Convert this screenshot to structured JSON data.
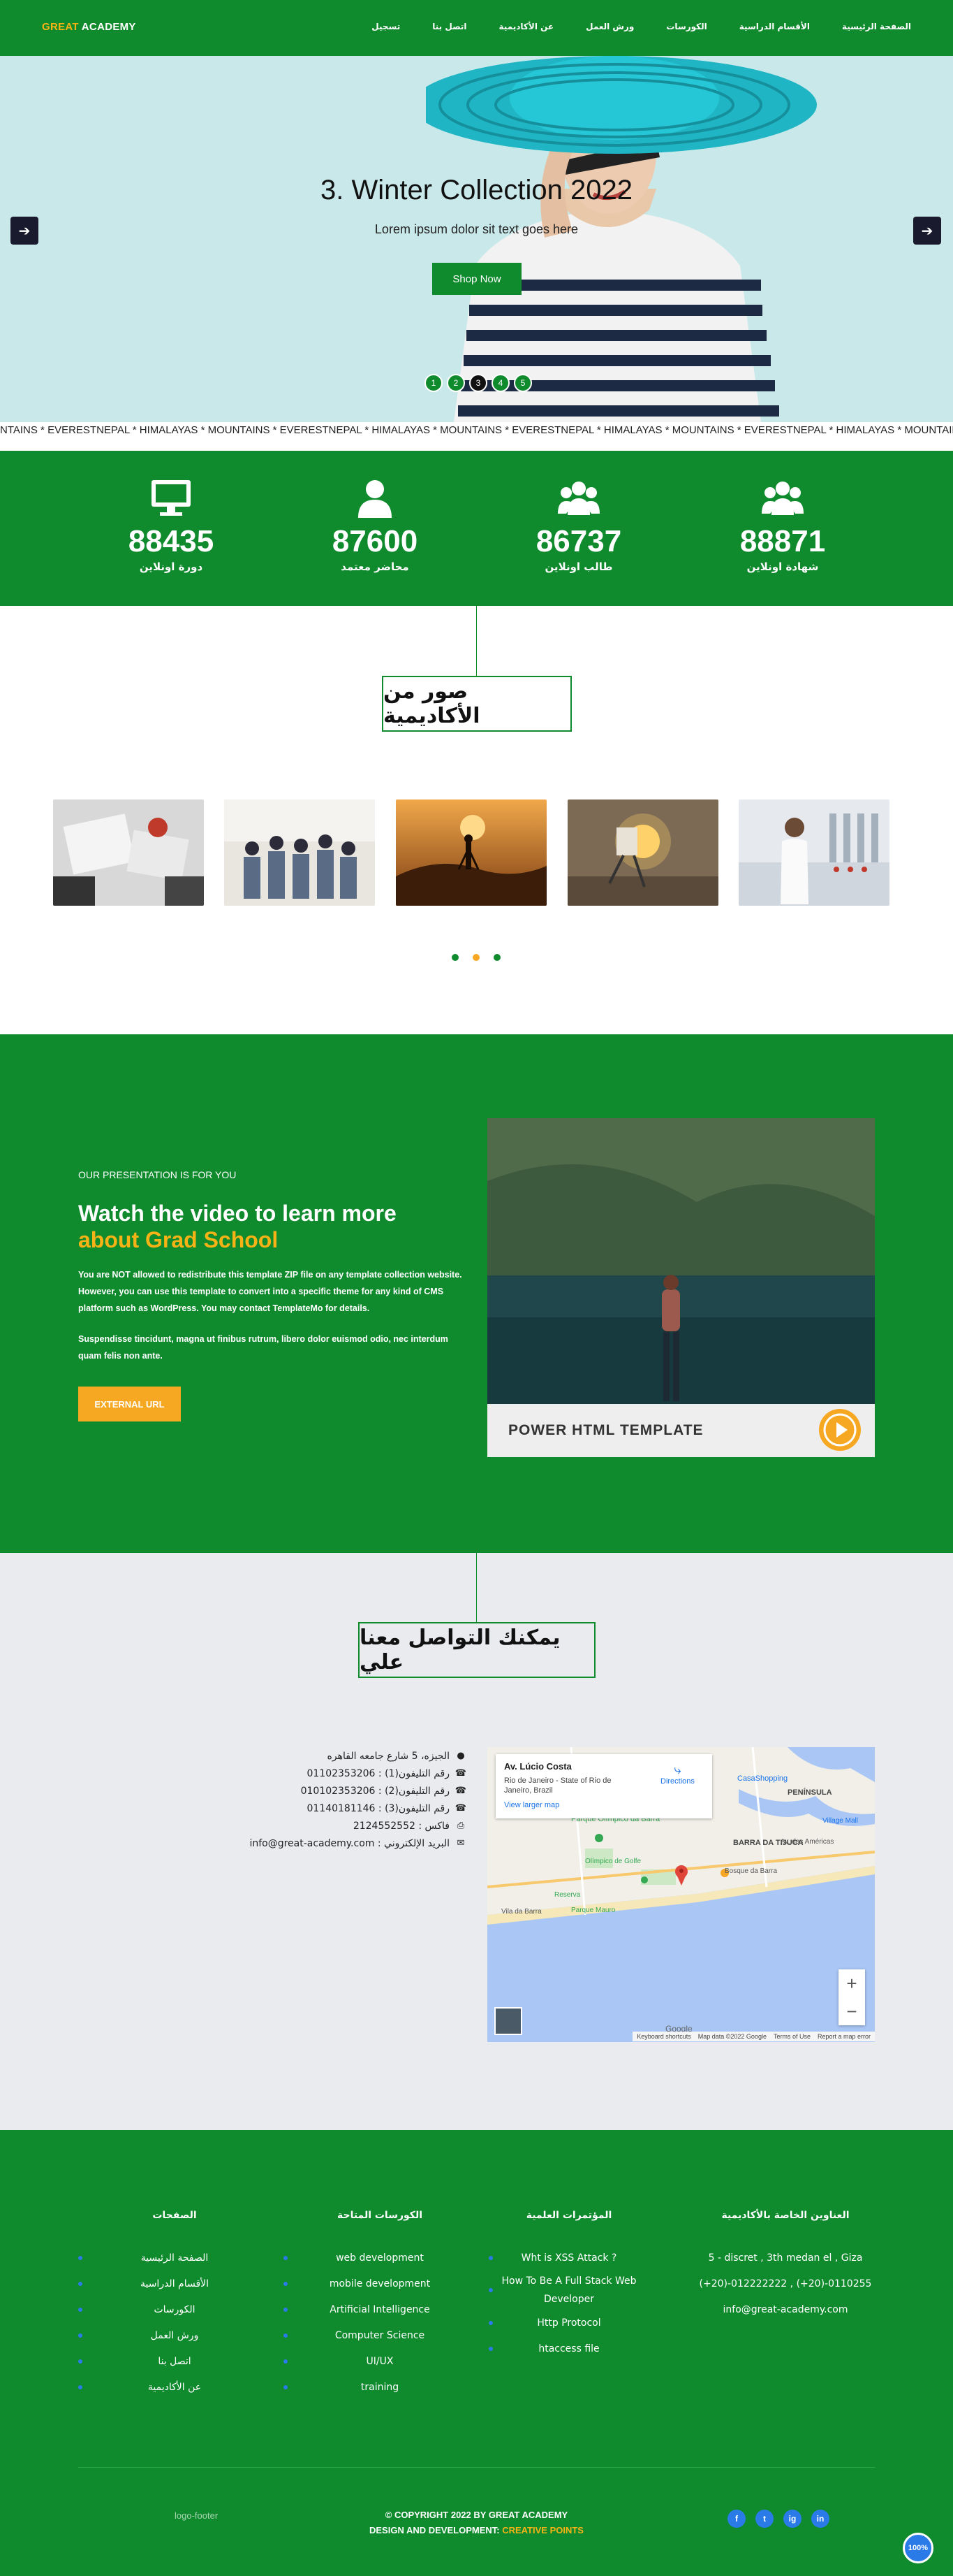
{
  "nav": {
    "brand_main": "GREAT",
    "brand_rest": " ACADEMY",
    "items": [
      "الصفحة الرئيسية",
      "الأقسام الدراسية",
      "الكورسات",
      "ورش العمل",
      "عن الأكاديمية",
      "اتصل بنا",
      "تسجيل"
    ]
  },
  "hero": {
    "title": "3. Winter Collection 2022",
    "subtitle": "Lorem ipsum dolor sit text goes here",
    "button": "Shop Now",
    "prev_icon": "arrow-left-icon",
    "next_icon": "arrow-right-icon",
    "dots": [
      "1",
      "2",
      "3",
      "4",
      "5"
    ],
    "active_dot": 3
  },
  "ticker": "NTAINS * EVERESTNEPAL * HIMALAYAS * MOUNTAINS * EVERESTNEPAL * HIMALAYAS * MOUNTAINS * EVERESTNEPAL * HIMALAYAS * MOUNTAINS * EVERESTNEPAL * HIMALAYAS * MOUNTAINS * EVERESTNEPAL * HIMALAYAS * MOUNTAINS * EVERESTNEPAL * HIMALAYAS * MOUNTAIN",
  "stats": [
    {
      "icon": "monitor-icon",
      "value": "88435",
      "label": "دورة اونلاين"
    },
    {
      "icon": "user-icon",
      "value": "87600",
      "label": "محاضر معتمد"
    },
    {
      "icon": "users-icon",
      "value": "86737",
      "label": "طالب اونلاين"
    },
    {
      "icon": "users-icon",
      "value": "88871",
      "label": "شهادة اونلاين"
    }
  ],
  "gallery": {
    "title": "صور من الأكاديمية",
    "dot_colors": [
      "#0f8a2d",
      "#f7a823",
      "#0f8a2d"
    ]
  },
  "video": {
    "eyebrow": "OUR PRESENTATION IS FOR YOU",
    "heading_1": "Watch the video to learn more",
    "heading_2": "about Grad School",
    "para_1": "You are NOT allowed to redistribute this template ZIP file on any template collection website. However, you can use this template to convert into a specific theme for any kind of CMS platform such as WordPress. You may contact TemplateMo for details.",
    "para_2": "Suspendisse tincidunt, magna ut finibus rutrum, libero dolor euismod odio, nec interdum quam felis non ante.",
    "button": "EXTERNAL URL",
    "video_caption": "POWER HTML TEMPLATE"
  },
  "contact": {
    "title": "يمكنك التواصل معنا علي",
    "rows": [
      {
        "icon": "map-pin-icon",
        "text": "الجيزه، 5 شارع جامعه القاهره"
      },
      {
        "icon": "phone-icon",
        "text": "رقم التليفون(1) : 01102353206"
      },
      {
        "icon": "phone-icon",
        "text": "رقم التليفون(2) : 010102353206"
      },
      {
        "icon": "phone-icon",
        "text": "رقم التليفون(3) : 01140181146"
      },
      {
        "icon": "fax-icon",
        "text": "فاكس : 2124552552"
      },
      {
        "icon": "envelope-icon",
        "text": "البريد الإلكتروني : info@great-academy.com"
      }
    ],
    "map": {
      "place": "Av. Lúcio Costa",
      "address": "Rio de Janeiro - State of Rio de Janeiro, Brazil",
      "directions": "Directions",
      "larger": "View larger map",
      "labels": [
        "CasaShopping",
        "PENÍNSULA",
        "Parque Olímpico da Barra",
        "BARRA DA TIJUCA",
        "Av. das Américas",
        "Reserva",
        "Vila da Barra",
        "Parque Mauro",
        "Bosque da Barra",
        "Village Mall",
        "Olímpico de Golfe"
      ],
      "footer_1": "Keyboard shortcuts",
      "footer_2": "Map data ©2022 Google",
      "footer_3": "Terms of Use",
      "footer_4": "Report a map error",
      "google": "Google"
    }
  },
  "footer": {
    "col1_title": "العناوين الخاصة بالأكاديمية",
    "col1_items": [
      "5 - discret , 3th medan el , Giza",
      "(+20)-012222222 , (+20)-0110255",
      "info@great-academy.com"
    ],
    "col2_title": "المؤتمرات العلمية",
    "col2_items": [
      "Wht is XSS Attack ?",
      "How To Be A Full Stack Web Developer",
      "Http Protocol",
      "htaccess file"
    ],
    "col3_title": "الكورسات المتاحة",
    "col3_items": [
      "web development",
      "mobile development",
      "Artificial Intelligence",
      "Computer Science",
      "UI/UX",
      "training"
    ],
    "col4_title": "الصفحات",
    "col4_items": [
      "الصفحة الرئيسية",
      "الأقسام الدراسية",
      "الكورسات",
      "ورش العمل",
      "اتصل بنا",
      "عن الأكاديمية"
    ],
    "logo_alt": "logo-footer",
    "copyright": "© COPYRIGHT 2022 BY GREAT ACADEMY",
    "design_label": "DESIGN AND DEVELOPMENT: ",
    "design_by": "CREATIVE POINTS",
    "social": [
      "f",
      "t",
      "ig",
      "in"
    ],
    "to_top": "100%"
  }
}
